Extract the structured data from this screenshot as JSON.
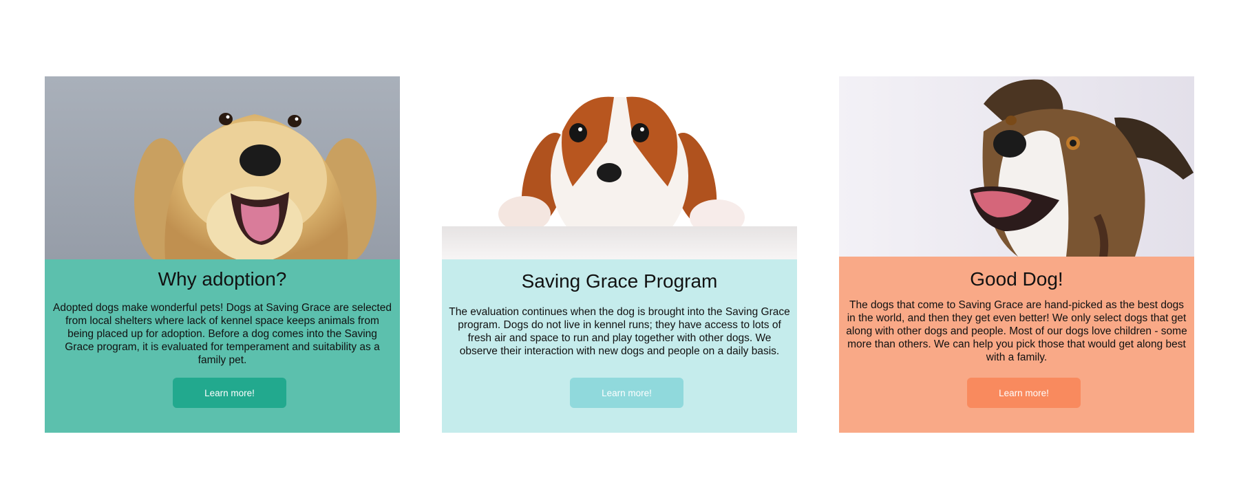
{
  "cards": [
    {
      "title": "Why adoption?",
      "text": "Adopted dogs make wonderful pets! Dogs at Saving Grace are selected from local shelters where lack of kennel space keeps animals from being placed up for adoption. Before a dog comes into the Saving Grace program, it is evaluated for temperament and suitability as a family pet.",
      "button_label": "Learn more!",
      "image": "golden-retriever-photo",
      "background": "#5cc0ad",
      "button_color": "#22a98e"
    },
    {
      "title": "Saving Grace Program",
      "text": "The evaluation continues when the dog is brought into the Saving Grace program. Dogs do not live in kennel runs; they have access to lots of fresh air and space to run and play together with other dogs. We observe their interaction with new dogs and people on a daily basis.",
      "button_label": "Learn more!",
      "image": "puppy-over-ledge-photo",
      "background": "#c5ecec",
      "button_color": "#90d9dc"
    },
    {
      "title": "Good Dog!",
      "text": "The dogs that come to Saving Grace are hand-picked as the best dogs in the world, and then they get even better! We only select dogs that get along with other dogs and people. Most of our dogs love children - some more than others. We can help you pick those that would get along best with a family.",
      "button_label": "Learn more!",
      "image": "happy-terrier-photo",
      "background": "#f9a987",
      "button_color": "#f98a5e"
    }
  ]
}
